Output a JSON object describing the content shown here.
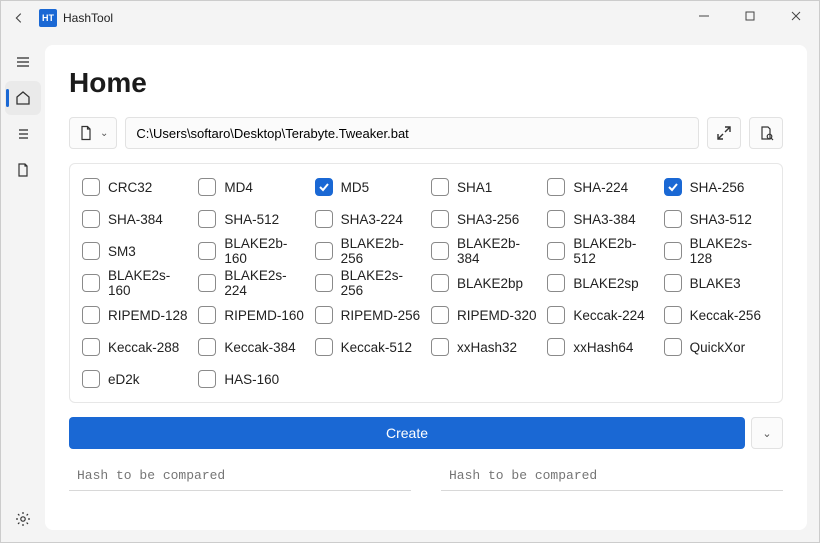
{
  "titlebar": {
    "title": "HashTool",
    "app_icon_text": "HT"
  },
  "sidebar": {
    "menu_icon": "menu",
    "home_icon": "home",
    "list_icon": "list",
    "doc_icon": "document",
    "settings_icon": "settings"
  },
  "page": {
    "heading": "Home",
    "file_path": "C:\\Users\\softaro\\Desktop\\Terabyte.Tweaker.bat",
    "create_label": "Create",
    "compare_placeholder_left": "Hash to be compared",
    "compare_placeholder_right": "Hash to be compared"
  },
  "algorithms": [
    {
      "label": "CRC32",
      "checked": false
    },
    {
      "label": "MD4",
      "checked": false
    },
    {
      "label": "MD5",
      "checked": true
    },
    {
      "label": "SHA1",
      "checked": false
    },
    {
      "label": "SHA-224",
      "checked": false
    },
    {
      "label": "SHA-256",
      "checked": true
    },
    {
      "label": "SHA-384",
      "checked": false
    },
    {
      "label": "SHA-512",
      "checked": false
    },
    {
      "label": "SHA3-224",
      "checked": false
    },
    {
      "label": "SHA3-256",
      "checked": false
    },
    {
      "label": "SHA3-384",
      "checked": false
    },
    {
      "label": "SHA3-512",
      "checked": false
    },
    {
      "label": "SM3",
      "checked": false
    },
    {
      "label": "BLAKE2b-160",
      "checked": false
    },
    {
      "label": "BLAKE2b-256",
      "checked": false
    },
    {
      "label": "BLAKE2b-384",
      "checked": false
    },
    {
      "label": "BLAKE2b-512",
      "checked": false
    },
    {
      "label": "BLAKE2s-128",
      "checked": false
    },
    {
      "label": "BLAKE2s-160",
      "checked": false
    },
    {
      "label": "BLAKE2s-224",
      "checked": false
    },
    {
      "label": "BLAKE2s-256",
      "checked": false
    },
    {
      "label": "BLAKE2bp",
      "checked": false
    },
    {
      "label": "BLAKE2sp",
      "checked": false
    },
    {
      "label": "BLAKE3",
      "checked": false
    },
    {
      "label": "RIPEMD-128",
      "checked": false
    },
    {
      "label": "RIPEMD-160",
      "checked": false
    },
    {
      "label": "RIPEMD-256",
      "checked": false
    },
    {
      "label": "RIPEMD-320",
      "checked": false
    },
    {
      "label": "Keccak-224",
      "checked": false
    },
    {
      "label": "Keccak-256",
      "checked": false
    },
    {
      "label": "Keccak-288",
      "checked": false
    },
    {
      "label": "Keccak-384",
      "checked": false
    },
    {
      "label": "Keccak-512",
      "checked": false
    },
    {
      "label": "xxHash32",
      "checked": false
    },
    {
      "label": "xxHash64",
      "checked": false
    },
    {
      "label": "QuickXor",
      "checked": false
    },
    {
      "label": "eD2k",
      "checked": false
    },
    {
      "label": "HAS-160",
      "checked": false
    }
  ]
}
